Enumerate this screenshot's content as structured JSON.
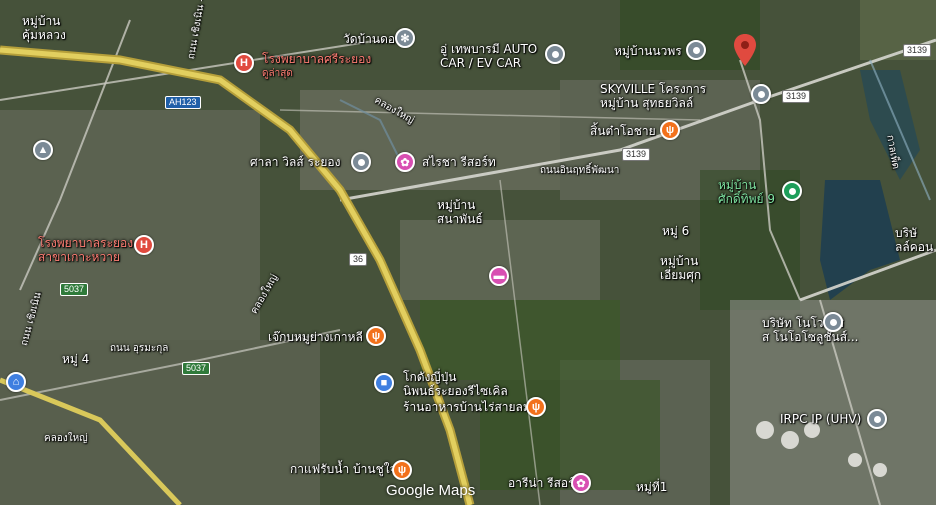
{
  "map": {
    "brand": "Google Maps",
    "labels": {
      "village_khum_luang": "หมู่บ้าน\nคุ้มหลวง",
      "road_chern_noen": "ถนน เชิงเนิน - ชากปั้ง",
      "hospital_srirayong": "โรงพยาบาลศรีระยอง",
      "hospital_srirayong_sub": "ดูล่าสุด",
      "wat_don": "วัดบ้านดอน",
      "auto_car": "อู่ เทพบารมี AUTO\nCAR / EV CAR",
      "village_nawaporn": "หมู่บ้านนวพร",
      "skyville": "SKYVILLE โครงการ\nหมู่บ้าน สุทธยวิลล์",
      "ah123": "AH123",
      "canal": "คลองใหญ่",
      "sin_tha": "สิ้นต๋าโอชาย",
      "court": "ศาลา วิลส์ ระยอง",
      "resort": "สไรชา รีสอร์ท",
      "road_3139_a": "3139",
      "road_3139_b": "3139",
      "road_3139_c": "3139",
      "road_dit": "ถนนอินฤทธิ์พัฒนา",
      "village_sak": "หมู่บ้าน\nศักดิ์ทิพย์ 9",
      "kachpet": "กาลเพ็ด",
      "company_right": "บริษั\nลล์คอน",
      "village_sanapan": "หมู่บ้าน\nสนาพันธ์",
      "hospital_rayong": "โรงพยาบาลระยอง\nสาขาเกาะหวาย",
      "moo6": "หมู่ 6",
      "village_iam": "หมู่บ้าน\nเอี่ยมศุก",
      "r36": "36",
      "r5037_a": "5037",
      "r5037_b": "5037",
      "bridge_road": "ถนน เชิงเนิน",
      "moo4": "หมู่ 4",
      "road_chun": "ถนน อุรมะกุล",
      "korean_bbq": "เจ๊กบหมูย่างเกาหลี",
      "company_pinova": "บริษัท โนโวเนซิ\nส โนโอโซลูชั่นส์...",
      "jp_auto": "โกดังญี่ปุ่น\nนิพนธ์ระยองรีไซเคิล",
      "restaurant_rai": "ร้านอาหารบ้านไร่สายลม",
      "irpc": "IRPC IP (UHV)",
      "coffee": "กาแฟรับน้ำ บ้านชูใจ",
      "arena_resort": "อารีน่า รีสอร์ท",
      "moo1": "หมู่ที่1",
      "khlong_yai": "คลองใหญ่"
    },
    "icons": {
      "temple": "gear-icon",
      "place": "place-icon",
      "food": "fork-knife-icon",
      "hotel": "bed-icon",
      "spa": "spa-icon",
      "shop": "shopping-bag-icon",
      "hospital": "hospital-icon",
      "school": "school-icon",
      "home": "home-icon",
      "marker": "map-pin-icon"
    },
    "colors": {
      "road": "#d9c85a",
      "water": "#1f3b4a",
      "pin_red": "#e04a3f"
    }
  }
}
